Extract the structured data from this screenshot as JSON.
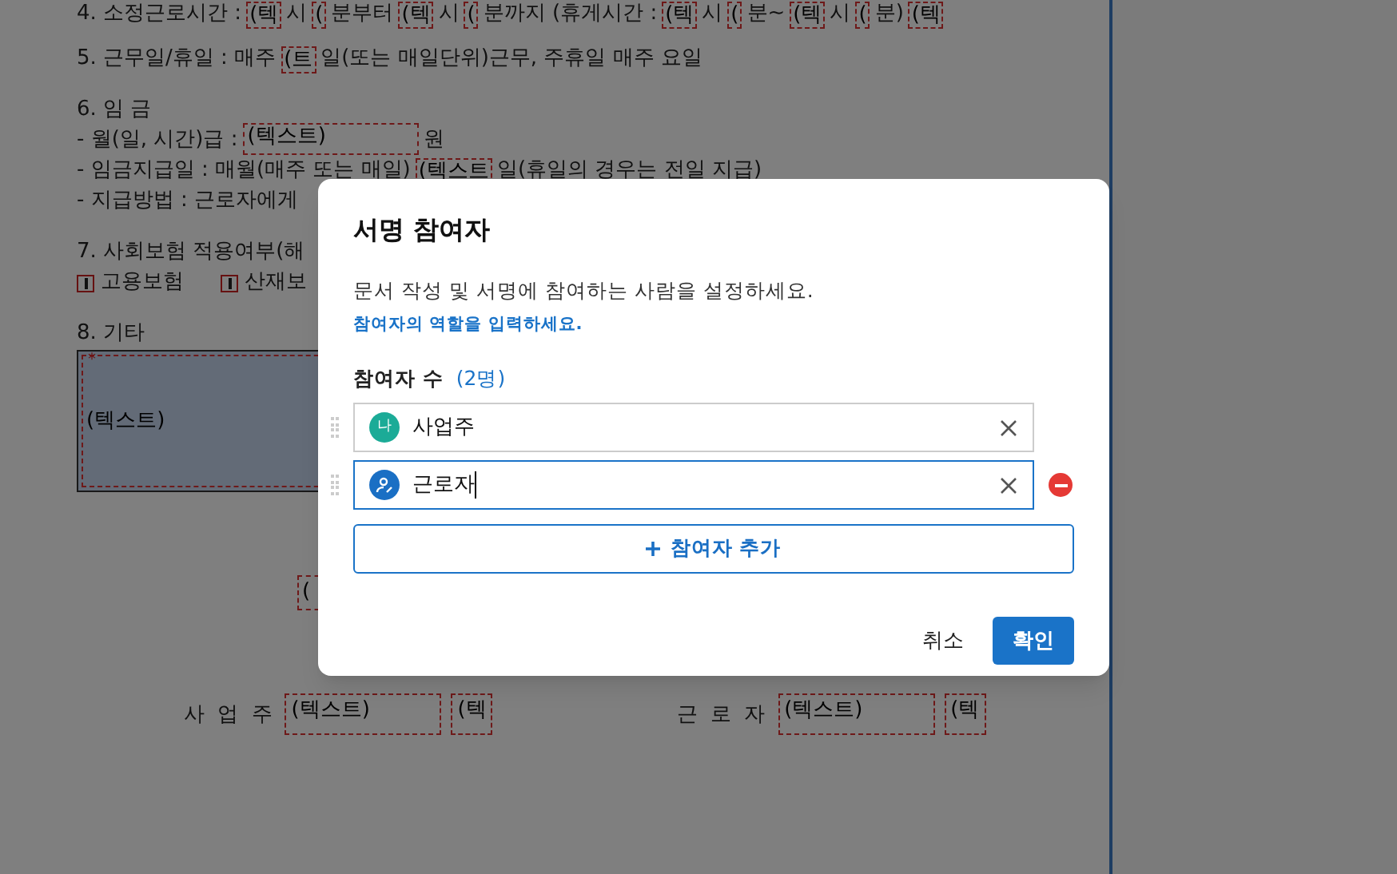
{
  "document": {
    "sections": [
      {
        "lines": [
          [
            {
              "kind": "text",
              "text": "4. 소정근로시간 :"
            },
            {
              "kind": "field",
              "text": "(텍"
            },
            {
              "kind": "text",
              "text": "시"
            },
            {
              "kind": "field",
              "text": "("
            },
            {
              "kind": "text",
              "text": "분부터"
            },
            {
              "kind": "field",
              "text": "(텍"
            },
            {
              "kind": "text",
              "text": "시"
            },
            {
              "kind": "field",
              "text": "("
            },
            {
              "kind": "text",
              "text": "분까지 (휴게시간 :"
            },
            {
              "kind": "field",
              "text": "(텍"
            },
            {
              "kind": "text",
              "text": "시"
            },
            {
              "kind": "field",
              "text": "("
            },
            {
              "kind": "text",
              "text": "분~"
            },
            {
              "kind": "field",
              "text": "(텍"
            },
            {
              "kind": "text",
              "text": "시"
            },
            {
              "kind": "field",
              "text": "("
            },
            {
              "kind": "text",
              "text": "분)"
            },
            {
              "kind": "field",
              "text": "(텍"
            }
          ]
        ]
      },
      {
        "lines": [
          [
            {
              "kind": "text",
              "text": "5. 근무일/휴일 : 매주"
            },
            {
              "kind": "field",
              "text": "(트"
            },
            {
              "kind": "text",
              "text": "일(또는 매일단위)근무, 주휴일 매주 요일"
            }
          ]
        ]
      },
      {
        "lines": [
          [
            {
              "kind": "text",
              "text": "6. 임 금"
            }
          ],
          [
            {
              "kind": "text",
              "text": " - 월(일, 시간)급 :"
            },
            {
              "kind": "long_field",
              "text": "(텍스트)"
            },
            {
              "kind": "text",
              "text": "원"
            }
          ],
          [
            {
              "kind": "text",
              "text": "- 임금지급일 : 매월(매주 또는 매일)"
            },
            {
              "kind": "field",
              "text": "(텍스트"
            },
            {
              "kind": "text",
              "text": "일(휴일의 경우는 전일 지급)"
            }
          ],
          [
            {
              "kind": "text",
              "text": "- 지급방법 : 근로자에게"
            }
          ]
        ]
      },
      {
        "lines": [
          [
            {
              "kind": "text",
              "text": "7. 사회보험 적용여부(해"
            }
          ],
          [
            {
              "kind": "checkbox",
              "text": "고용보험",
              "checked": true
            },
            {
              "kind": "checkbox",
              "text": "산재보",
              "checked": true
            }
          ]
        ]
      },
      {
        "lines": [
          [
            {
              "kind": "text",
              "text": "8. 기타"
            }
          ]
        ]
      }
    ],
    "memo_box": {
      "marker": "*",
      "text": "(텍스트)"
    },
    "lone_field": {
      "text": "("
    },
    "signatures": [
      {
        "label": "사 업 주",
        "fields": [
          "(텍스트)",
          "(텍"
        ]
      },
      {
        "label": "근 로 자",
        "fields": [
          "(텍스트)",
          "(텍"
        ]
      }
    ]
  },
  "dialog": {
    "title": "서명 참여자",
    "description": "문서 작성 및 서명에 참여하는 사람을 설정하세요.",
    "hint": "참여자의 역할을 입력하세요.",
    "count_label": "참여자 수",
    "count": "(2명)",
    "participants": [
      {
        "kind": "self",
        "badge": "나",
        "role": "사업주",
        "focused": false,
        "removable": false
      },
      {
        "kind": "person",
        "role": "근로자",
        "focused": true,
        "removable": true
      }
    ],
    "add_button": "참여자 추가",
    "cancel": "취소",
    "confirm": "확인"
  }
}
